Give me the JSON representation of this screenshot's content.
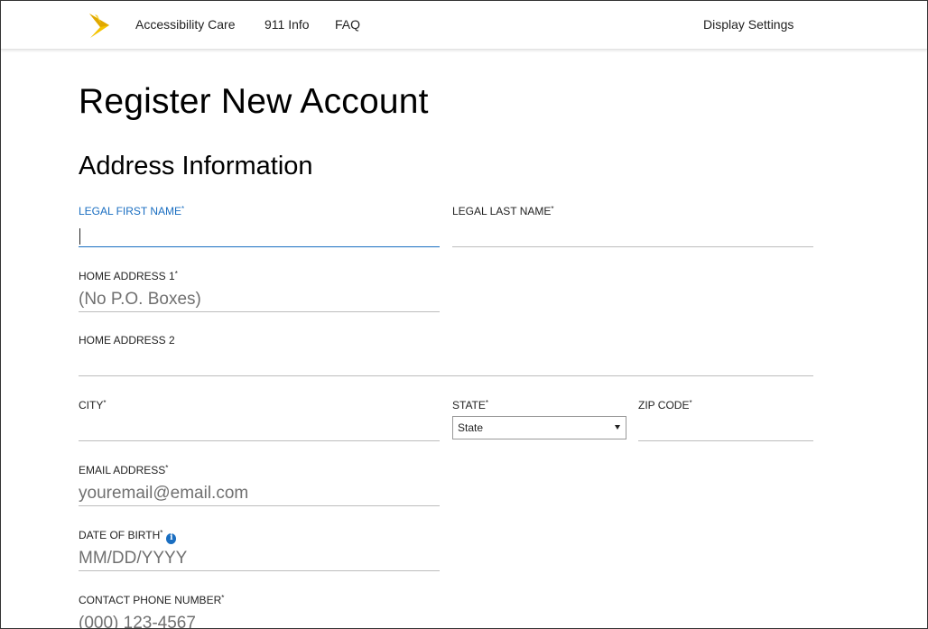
{
  "header": {
    "logo_icon": "sprint-logo-icon",
    "nav": {
      "accessibility": "Accessibility Care",
      "info_911": "911 Info",
      "faq": "FAQ",
      "display_settings": "Display Settings"
    }
  },
  "page": {
    "title": "Register New Account",
    "section_title": "Address Information"
  },
  "form": {
    "required_mark": "*",
    "first_name": {
      "label": "LEGAL FIRST NAME",
      "value": "",
      "placeholder": ""
    },
    "last_name": {
      "label": "LEGAL LAST NAME",
      "value": "",
      "placeholder": ""
    },
    "address1": {
      "label": "HOME ADDRESS 1",
      "placeholder": "(No P.O. Boxes)"
    },
    "address2": {
      "label": "HOME ADDRESS 2",
      "placeholder": ""
    },
    "city": {
      "label": "CITY",
      "placeholder": ""
    },
    "state": {
      "label": "STATE",
      "selected": "State"
    },
    "zip": {
      "label": "ZIP CODE",
      "placeholder": ""
    },
    "email": {
      "label": "EMAIL ADDRESS",
      "placeholder": "youremail@email.com"
    },
    "dob": {
      "label": "DATE OF BIRTH",
      "placeholder": "MM/DD/YYYY",
      "info_icon": "i"
    },
    "phone": {
      "label": "CONTACT PHONE NUMBER",
      "placeholder": "(000) 123-4567"
    }
  },
  "colors": {
    "accent": "#1a6ec1",
    "logo": "#f5c400"
  }
}
